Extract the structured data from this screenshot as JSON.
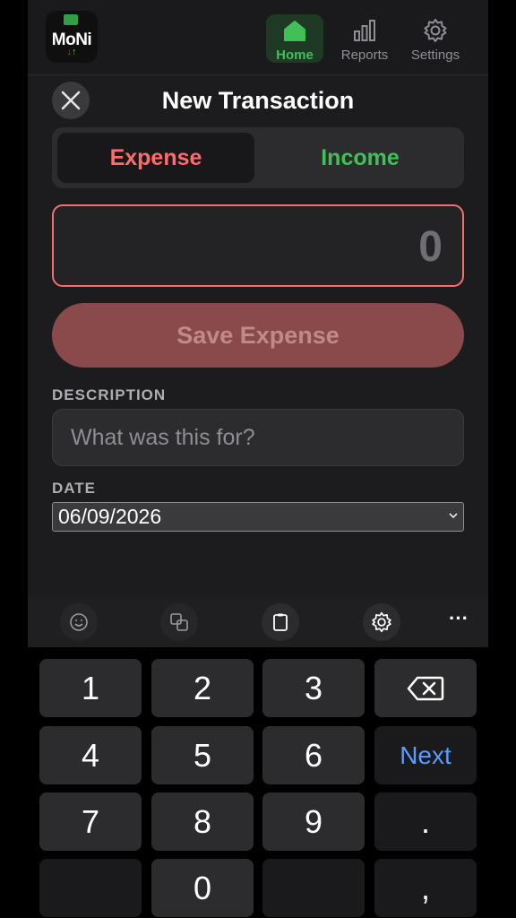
{
  "app": {
    "brand": "MoNi",
    "brand_arrows": {
      "down": "↓",
      "up": "↑"
    }
  },
  "nav": {
    "items": [
      {
        "label": "Home",
        "icon": "home-icon",
        "active": true
      },
      {
        "label": "Reports",
        "icon": "bar-chart-icon",
        "active": false
      },
      {
        "label": "Settings",
        "icon": "gear-icon",
        "active": false
      }
    ]
  },
  "form": {
    "title": "New Transaction",
    "close_icon": "close-icon",
    "tabs": {
      "expense": "Expense",
      "income": "Income",
      "selected": "Expense"
    },
    "amount": "0",
    "save_label": "Save Expense",
    "description": {
      "label": "DESCRIPTION",
      "placeholder": "What was this for?",
      "value": ""
    },
    "date": {
      "label": "DATE",
      "value": "06/09/2026"
    }
  },
  "keyboard": {
    "toolbar": [
      "emoji-icon",
      "translate-icon",
      "clipboard-icon",
      "gear-icon",
      "more-icon"
    ],
    "more": "···",
    "keys": {
      "k1": "1",
      "k2": "2",
      "k3": "3",
      "k4": "4",
      "k5": "5",
      "k6": "6",
      "k7": "7",
      "k8": "8",
      "k9": "9",
      "k0": "0",
      "dot": ".",
      "comma": ",",
      "next": "Next"
    }
  },
  "colors": {
    "expense": "#ff6b6b",
    "income": "#40c057",
    "save_disabled_bg": "#8a4a4c",
    "next": "#5e9bff"
  }
}
